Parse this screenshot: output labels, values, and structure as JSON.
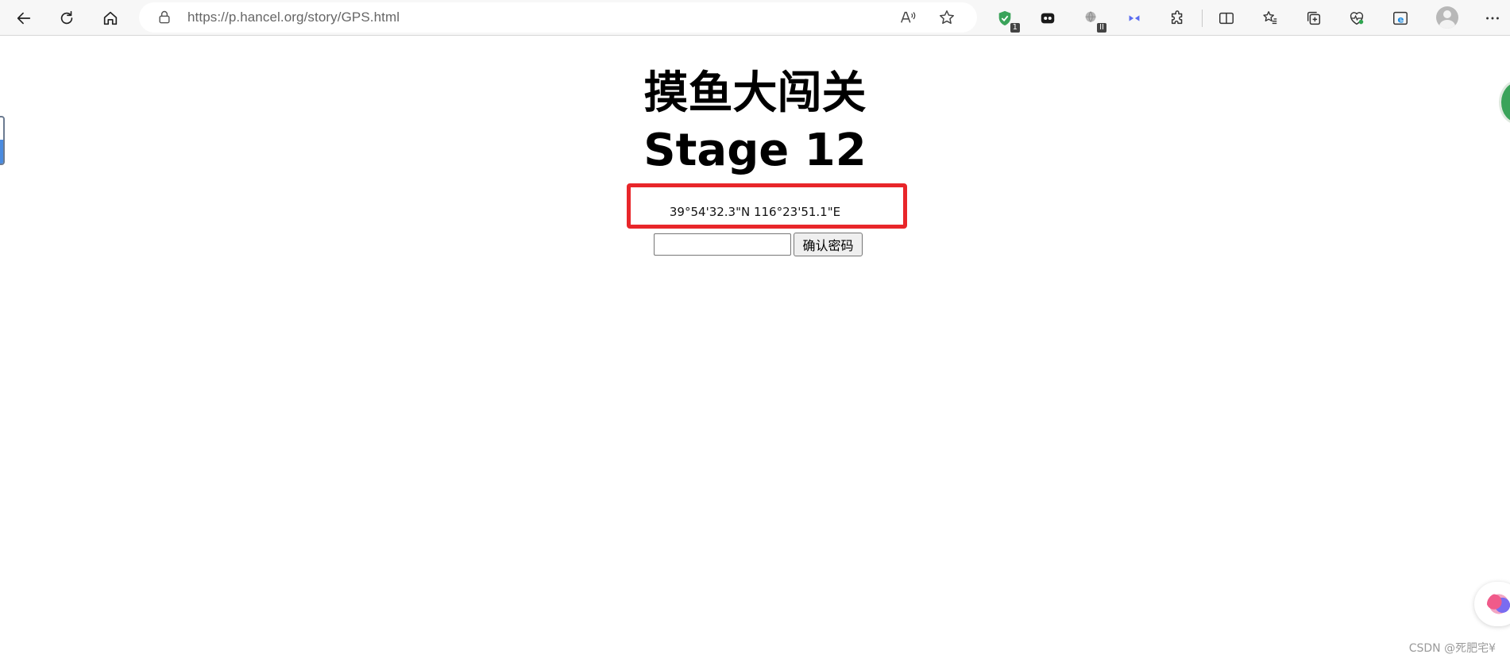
{
  "browser": {
    "url_host": "https://p.hancel.org",
    "url_path": "/story/GPS.html",
    "extensions": [
      {
        "name": "shield-extension",
        "badge": "1"
      },
      {
        "name": "dark-extension"
      },
      {
        "name": "paused-extension",
        "badge": "II"
      },
      {
        "name": "blue-extension"
      }
    ]
  },
  "page": {
    "title": "摸鱼大闯关",
    "subtitle": "Stage 12",
    "coordinates": "39°54'32.3\"N 116°23'51.1\"E",
    "password_value": "",
    "confirm_label": "确认密码"
  },
  "watermark": "CSDN @死肥宅¥",
  "colors": {
    "highlight_border": "#e8262a",
    "shield_green": "#3aa35a"
  }
}
